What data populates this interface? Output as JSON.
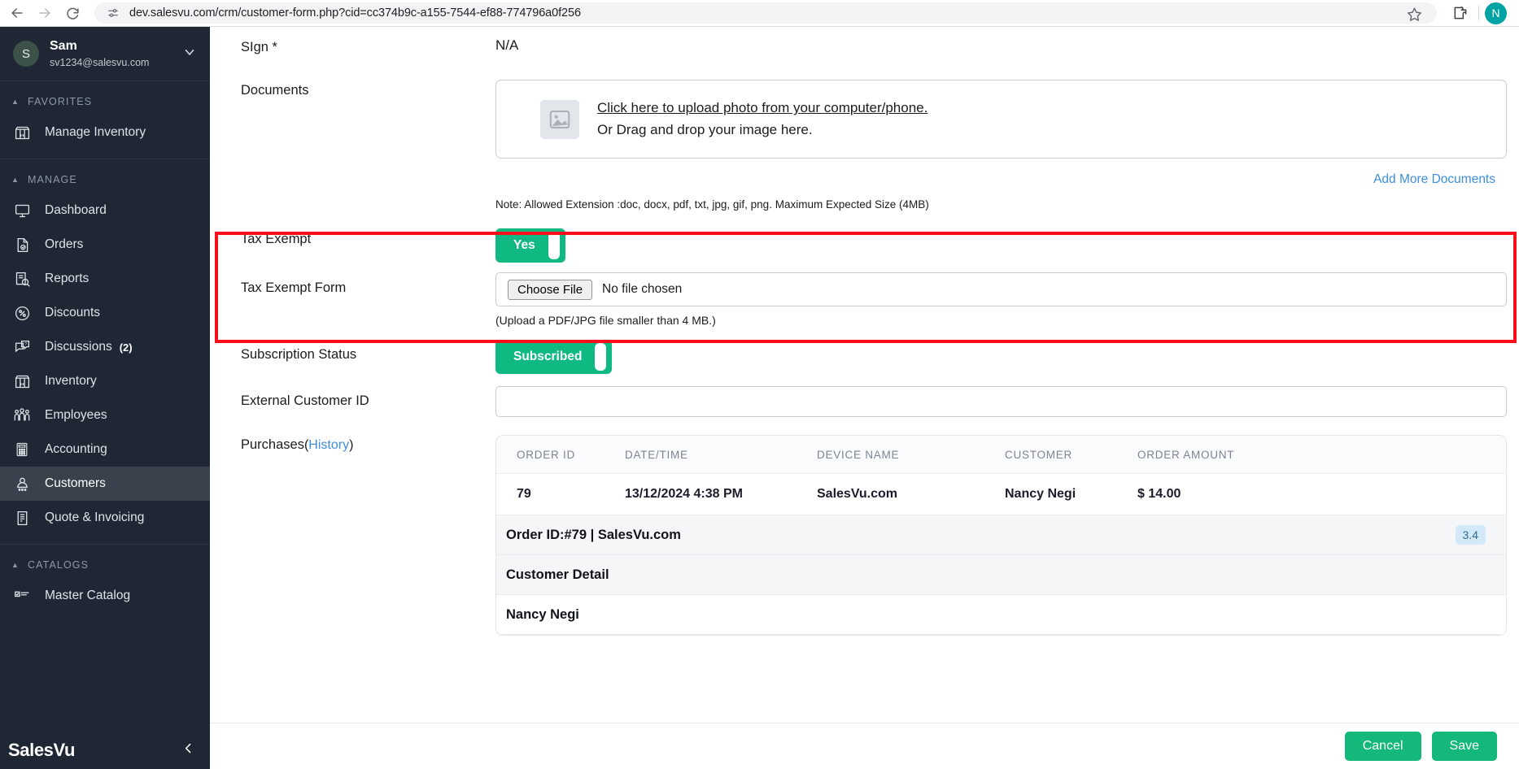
{
  "browser": {
    "url": "dev.salesvu.com/crm/customer-form.php?cid=cc374b9c-a155-7544-ef88-774796a0f256",
    "back_icon": "back-arrow-icon",
    "forward_icon": "forward-arrow-icon",
    "reload_icon": "reload-icon",
    "site_info_icon": "site-settings-icon",
    "bookmark_icon": "star-icon",
    "extensions_icon": "extensions-puzzle-icon",
    "profile_initial": "N"
  },
  "sidebar": {
    "user": {
      "initial": "S",
      "name": "Sam",
      "email": "sv1234@salesvu.com",
      "chevron": "chevron-down-icon"
    },
    "sections": [
      {
        "title": "FAVORITES",
        "items": [
          {
            "label": "Manage Inventory",
            "icon": "store-icon",
            "badge": "",
            "active": false
          }
        ]
      },
      {
        "title": "MANAGE",
        "items": [
          {
            "label": "Dashboard",
            "icon": "monitor-icon",
            "badge": "",
            "active": false
          },
          {
            "label": "Orders",
            "icon": "order-document-icon",
            "badge": "",
            "active": false
          },
          {
            "label": "Reports",
            "icon": "report-search-icon",
            "badge": "",
            "active": false
          },
          {
            "label": "Discounts",
            "icon": "percent-badge-icon",
            "badge": "",
            "active": false
          },
          {
            "label": "Discussions",
            "icon": "chat-question-icon",
            "badge": "(2)",
            "active": false
          },
          {
            "label": "Inventory",
            "icon": "store-icon",
            "badge": "",
            "active": false
          },
          {
            "label": "Employees",
            "icon": "people-group-icon",
            "badge": "",
            "active": false
          },
          {
            "label": "Accounting",
            "icon": "calculator-icon",
            "badge": "",
            "active": false
          },
          {
            "label": "Customers",
            "icon": "customer-person-icon",
            "badge": "",
            "active": true
          },
          {
            "label": "Quote & Invoicing",
            "icon": "invoice-document-icon",
            "badge": "",
            "active": false
          }
        ]
      },
      {
        "title": "CATALOGS",
        "items": [
          {
            "label": "Master Catalog",
            "icon": "catalog-list-icon",
            "badge": "",
            "active": false
          }
        ]
      }
    ],
    "footer": {
      "logo": "SalesVu",
      "collapse_icon": "chevron-left-icon"
    }
  },
  "form": {
    "sign": {
      "label": "SIgn *",
      "value": "N/A"
    },
    "documents": {
      "label": "Documents",
      "upload_link": "Click here to upload photo from your computer/phone.",
      "drag_text": "Or Drag and drop your image here.",
      "image_icon": "image-placeholder-icon",
      "add_more_label": "Add More Documents",
      "note": "Note: Allowed Extension :doc, docx, pdf, txt, jpg, gif, png. Maximum Expected Size (4MB)"
    },
    "tax_exempt": {
      "label": "Tax Exempt",
      "toggle_value": "Yes"
    },
    "tax_exempt_form": {
      "label": "Tax Exempt Form",
      "choose_file_label": "Choose File",
      "no_file_text": "No file chosen",
      "note": "(Upload a PDF/JPG file smaller than 4 MB.)"
    },
    "subscription_status": {
      "label": "Subscription Status",
      "toggle_value": "Subscribed"
    },
    "external_customer_id": {
      "label": "External Customer ID",
      "value": "",
      "placeholder": ""
    },
    "purchases": {
      "label": "Purchases",
      "history_link": "History",
      "open_paren": "(",
      "close_paren": ")",
      "columns": [
        "ORDER ID",
        "DATE/TIME",
        "DEVICE NAME",
        "CUSTOMER",
        "ORDER AMOUNT"
      ],
      "rows": [
        {
          "order_id": "79",
          "datetime": "13/12/2024 4:38 PM",
          "device_name": "SalesVu.com",
          "customer": "Nancy Negi",
          "order_amount": "$ 14.00"
        }
      ],
      "detail": {
        "order_header": "Order ID:#79 | SalesVu.com",
        "score_badge": "3.4",
        "customer_detail_label": "Customer Detail",
        "customer_name": "Nancy Negi"
      }
    }
  },
  "footer": {
    "cancel_label": "Cancel",
    "save_label": "Save"
  },
  "colors": {
    "accent_green": "#14b87b",
    "toggle_green": "#10b981",
    "link_blue": "#3e8ede",
    "highlight_red": "#fc0d1b",
    "sidebar_bg": "#1e2733"
  }
}
